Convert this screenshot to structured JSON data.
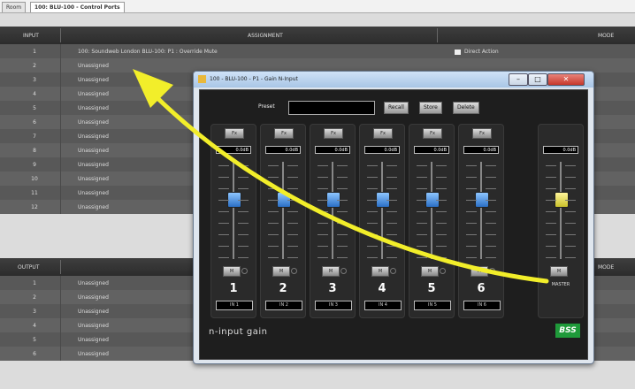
{
  "tabs": {
    "room": "Room",
    "current": "100: BLU-100 - Control Ports"
  },
  "input_table": {
    "headers": {
      "col1": "INPUT",
      "col2": "ASSIGNMENT",
      "col3": "MODE"
    },
    "rows": [
      {
        "num": "1",
        "assignment": "100: Soundweb London BLU-100: P1 : Override Mute",
        "mode": "Direct Action"
      },
      {
        "num": "2",
        "assignment": "Unassigned"
      },
      {
        "num": "3",
        "assignment": "Unassigned"
      },
      {
        "num": "4",
        "assignment": "Unassigned"
      },
      {
        "num": "5",
        "assignment": "Unassigned"
      },
      {
        "num": "6",
        "assignment": "Unassigned"
      },
      {
        "num": "7",
        "assignment": "Unassigned"
      },
      {
        "num": "8",
        "assignment": "Unassigned"
      },
      {
        "num": "9",
        "assignment": "Unassigned"
      },
      {
        "num": "10",
        "assignment": "Unassigned"
      },
      {
        "num": "11",
        "assignment": "Unassigned"
      },
      {
        "num": "12",
        "assignment": "Unassigned"
      }
    ]
  },
  "output_table": {
    "headers": {
      "col1": "OUTPUT",
      "col3": "MODE"
    },
    "rows": [
      {
        "num": "1",
        "assignment": "Unassigned"
      },
      {
        "num": "2",
        "assignment": "Unassigned"
      },
      {
        "num": "3",
        "assignment": "Unassigned"
      },
      {
        "num": "4",
        "assignment": "Unassigned"
      },
      {
        "num": "5",
        "assignment": "Unassigned"
      },
      {
        "num": "6",
        "assignment": "Unassigned"
      }
    ]
  },
  "dialog": {
    "title": "100 - BLU-100 - P1 - Gain N-Input",
    "preset_label": "Preset",
    "buttons": {
      "recall": "Recall",
      "store": "Store",
      "delete": "Delete"
    },
    "channels": [
      {
        "number": "1",
        "db": "0.0dB",
        "label": "IN 1",
        "fader_level": 0.62
      },
      {
        "number": "2",
        "db": "0.0dB",
        "label": "IN 2",
        "fader_level": 0.62
      },
      {
        "number": "3",
        "db": "0.0dB",
        "label": "IN 3",
        "fader_level": 0.62
      },
      {
        "number": "4",
        "db": "0.0dB",
        "label": "IN 4",
        "fader_level": 0.62
      },
      {
        "number": "5",
        "db": "0.0dB",
        "label": "IN 5",
        "fader_level": 0.62
      },
      {
        "number": "6",
        "db": "0.0dB",
        "label": "IN 6",
        "fader_level": 0.62
      }
    ],
    "master": {
      "db": "0.0dB",
      "label": "MASTER",
      "fader_level": 0.62
    },
    "fx_label": "Fx",
    "mute_label": "M",
    "brand": "n-input gain",
    "logo_text": "BSS",
    "colors": {
      "fader_channel": "#3a8ee6",
      "fader_master": "#e8e04a",
      "arrow": "#f2ee2a"
    }
  }
}
